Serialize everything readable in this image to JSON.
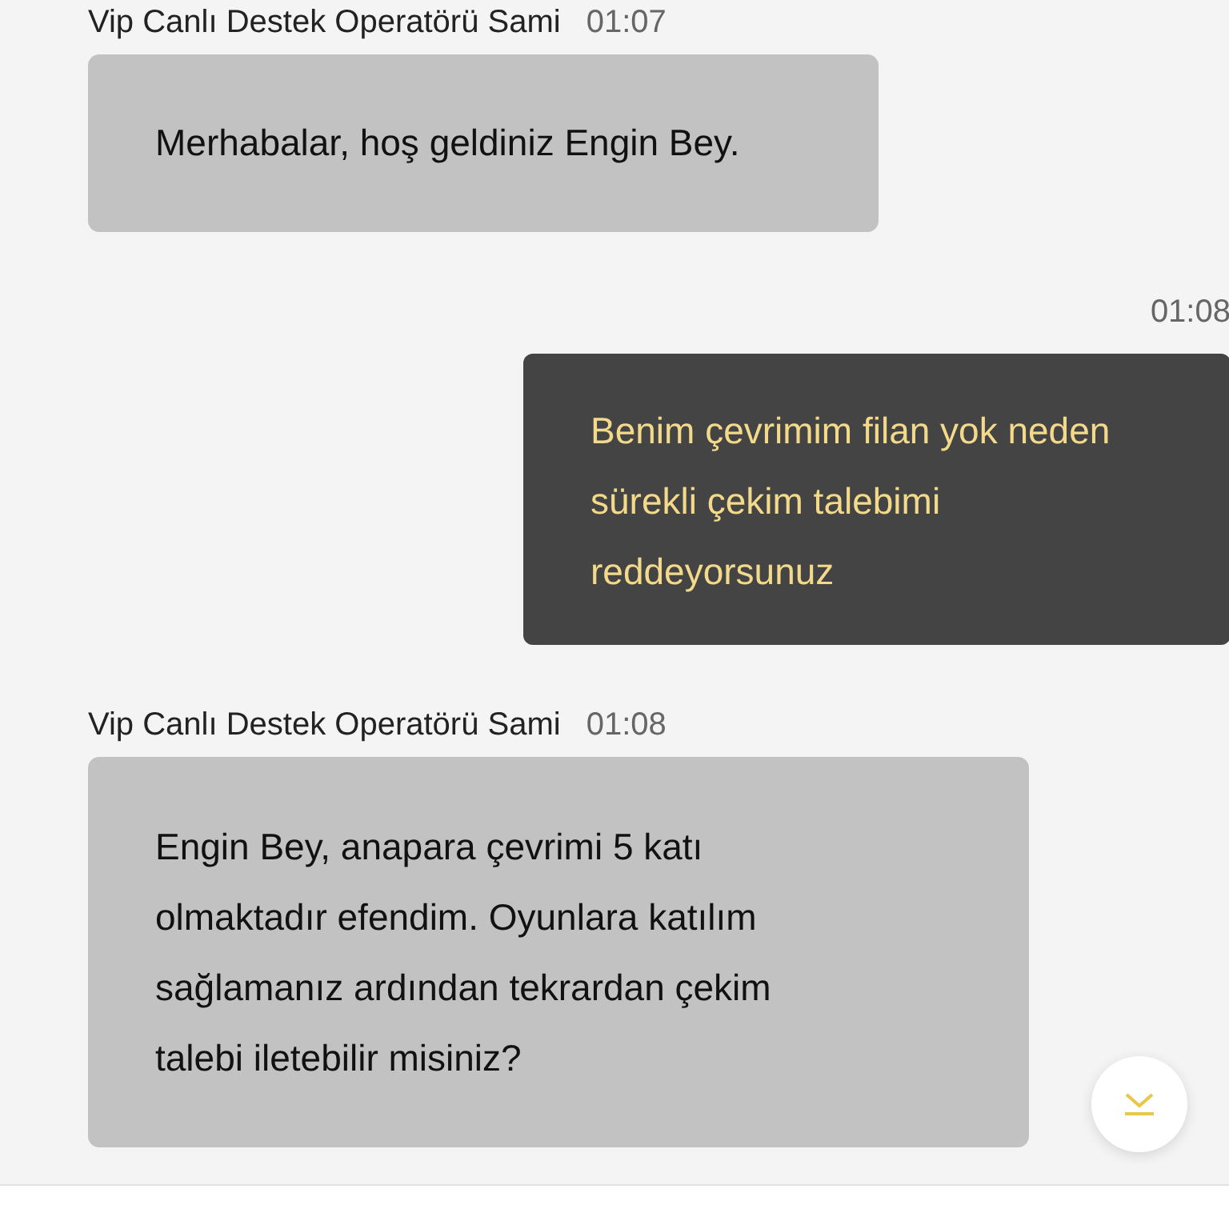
{
  "messages": [
    {
      "kind": "incoming",
      "sender": "Vip Canlı Destek Operatörü Sami",
      "time": "01:07",
      "text": "Merhabalar, hoş geldiniz Engin Bey."
    },
    {
      "kind": "outgoing",
      "time": "01:08",
      "text": "Benim çevrimim filan yok neden sürekli çekim talebimi reddeyorsunuz"
    },
    {
      "kind": "incoming",
      "sender": "Vip Canlı Destek Operatörü Sami",
      "time": "01:08",
      "text": "Engin Bey, anapara çevrimi 5 katı olmaktadır efendim. Oyunlara katılım sağlamanız ardından tekrardan çekim talebi iletebilir misiniz?"
    }
  ]
}
